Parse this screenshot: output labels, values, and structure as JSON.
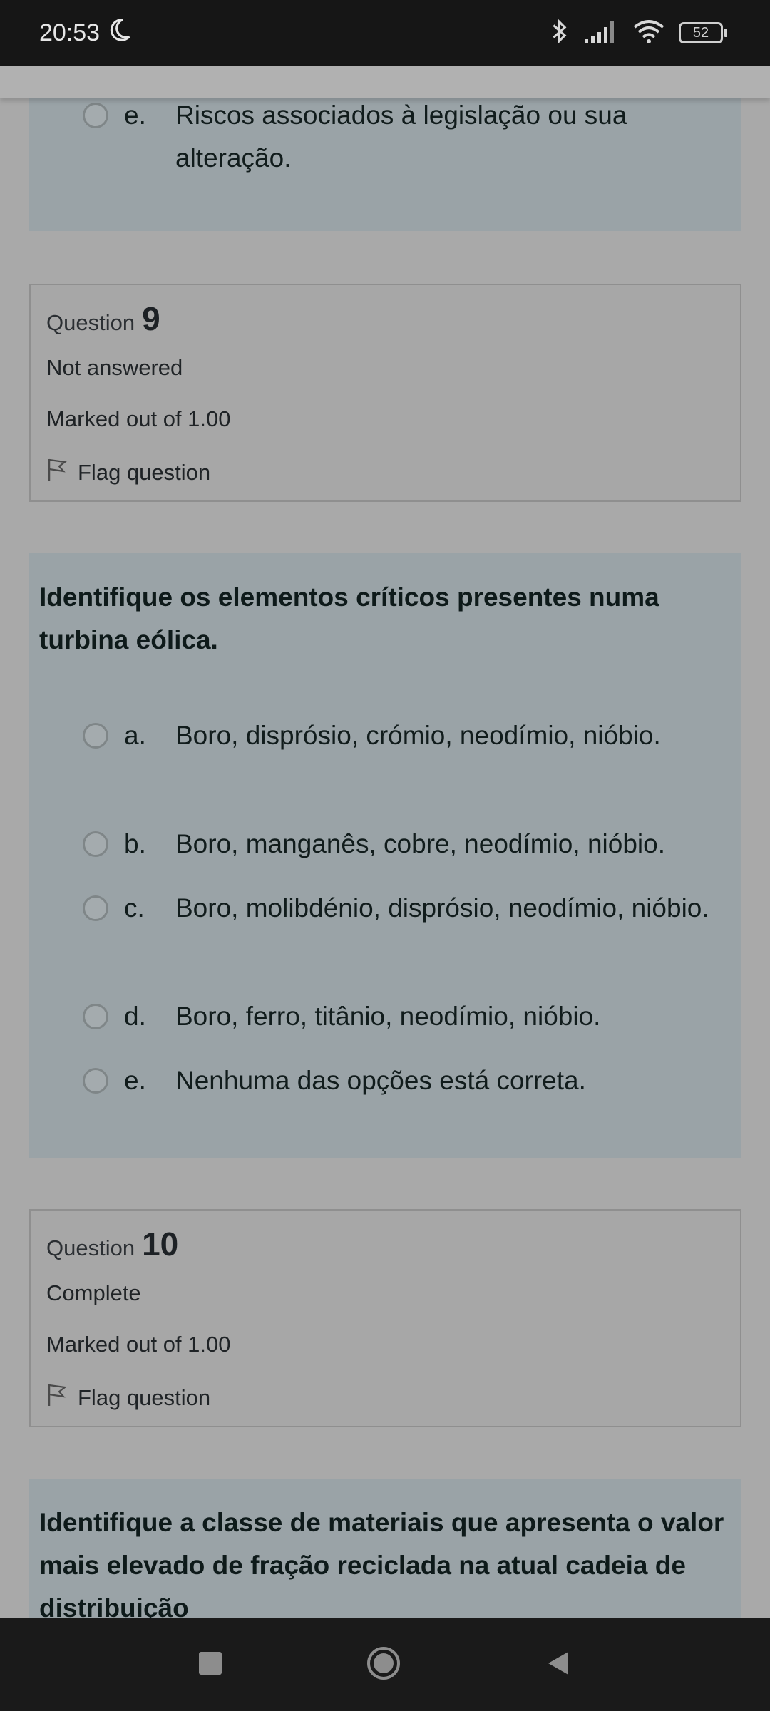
{
  "status_bar": {
    "time": "20:53",
    "icons": [
      "moon-icon",
      "bluetooth-icon",
      "signal-icon",
      "wifi-icon"
    ],
    "battery": "52"
  },
  "q8_tail": {
    "option_e": {
      "letter": "e.",
      "text": "Riscos associados à legislação ou sua alteração."
    }
  },
  "q9": {
    "word": "Question",
    "number": "9",
    "state": "Not answered",
    "mark": "Marked out of 1.00",
    "flag_label": "Flag question",
    "prompt": "Identifique os elementos críticos presentes numa turbina eólica.",
    "options": [
      {
        "letter": "a.",
        "text": "Boro, disprósio, crómio, neodímio, nióbio."
      },
      {
        "letter": "b.",
        "text": "Boro, manganês, cobre, neodímio, nióbio."
      },
      {
        "letter": "c.",
        "text": "Boro, molibdénio, disprósio, neodímio, nióbio."
      },
      {
        "letter": "d.",
        "text": "Boro, ferro, titânio, neodímio, nióbio."
      },
      {
        "letter": "e.",
        "text": "Nenhuma das opções está correta."
      }
    ]
  },
  "q10": {
    "word": "Question",
    "number": "10",
    "state": "Complete",
    "mark": "Marked out of 1.00",
    "flag_label": "Flag question",
    "prompt": "Identifique a classe de materiais que apresenta o valor mais elevado de fração reciclada na atual cadeia de distribuição"
  },
  "nav_bar": {
    "buttons": [
      "recents-square-icon",
      "home-circle-icon",
      "back-triangle-icon"
    ]
  }
}
